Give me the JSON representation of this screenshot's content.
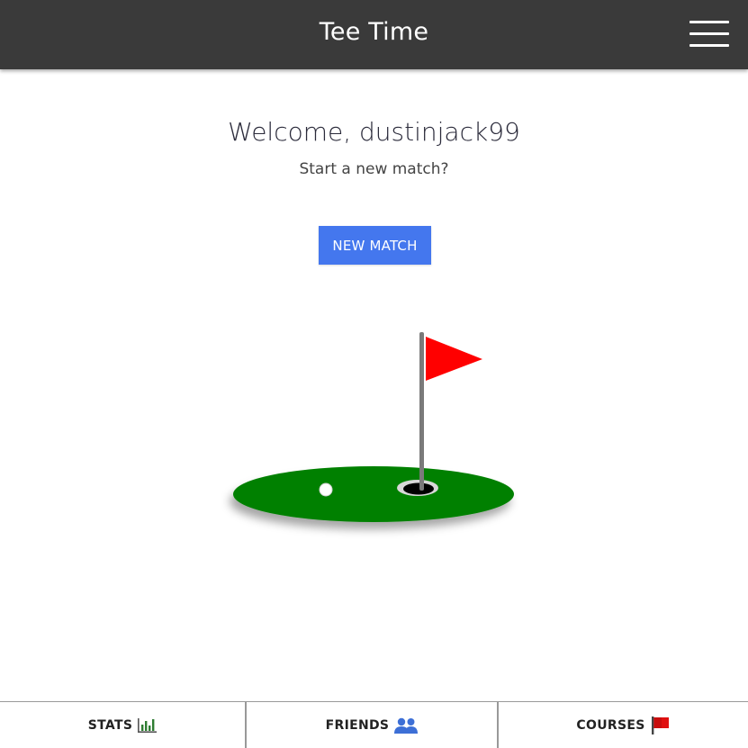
{
  "header": {
    "title": "Tee Time",
    "menu_icon": "hamburger-menu-icon"
  },
  "main": {
    "welcome": "Welcome, dustinjack99",
    "subtitle": "Start a new match?",
    "new_match_label": "NEW MATCH"
  },
  "illustration": {
    "flag_color": "#ff0000",
    "green_color": "#008000",
    "pole_color": "#7a7a7a"
  },
  "bottom_nav": {
    "items": [
      {
        "label": "STATS",
        "icon": "bar-chart-icon",
        "color": "#2e7d32"
      },
      {
        "label": "FRIENDS",
        "icon": "people-icon",
        "color": "#3d6fd6"
      },
      {
        "label": "COURSES",
        "icon": "red-flag-icon",
        "color": "#e01010"
      }
    ]
  },
  "colors": {
    "topbar": "#3a3a3a",
    "accent": "#4477ee"
  }
}
